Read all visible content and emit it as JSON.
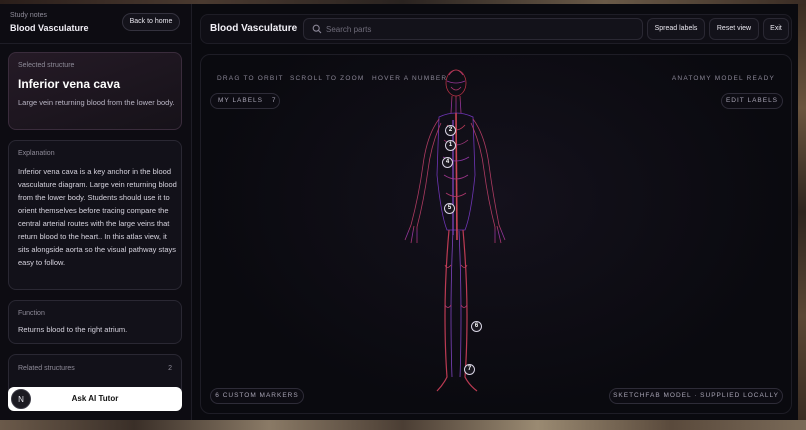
{
  "sidebar": {
    "study_label": "Study notes",
    "study_title": "Blood Vasculature",
    "back_label": "Back to home",
    "selected": {
      "label": "Selected structure",
      "name": "Inferior vena cava",
      "description": "Large vein returning blood from the lower body."
    },
    "explanation": {
      "label": "Explanation",
      "text": "Inferior vena cava is a key anchor in the blood vasculature diagram. Large vein returning blood from the lower body. Students should use it to orient themselves before tracing compare the central arterial routes with the large veins that return blood to the heart.. In this atlas view, it sits alongside aorta so the visual pathway stays easy to follow."
    },
    "function": {
      "label": "Function",
      "text": "Returns blood to the right atrium."
    },
    "related": {
      "label": "Related structures",
      "count": "2"
    },
    "tutor": {
      "avatar_letter": "N",
      "label": "Ask AI Tutor"
    }
  },
  "topbar": {
    "title": "Blood Vasculature",
    "search_placeholder": "Search parts",
    "spread_label": "Spread labels",
    "reset_label": "Reset view",
    "exit_label": "Exit"
  },
  "viewer": {
    "hints": [
      "DRAG TO ORBIT",
      "SCROLL TO ZOOM",
      "HOVER A NUMBER"
    ],
    "status": "ANATOMY MODEL READY",
    "my_labels": "MY LABELS",
    "my_labels_count": "7",
    "edit_labels": "EDIT LABELS",
    "custom_markers": "6 CUSTOM MARKERS",
    "source": "SKETCHFAB MODEL · SUPPLIED LOCALLY",
    "markers": [
      "2",
      "1",
      "4",
      "5",
      "6",
      "7"
    ]
  },
  "colors": {
    "accent": "#c04a7a",
    "vessel_red": "#c8364a",
    "vessel_purple": "#7a3ac8"
  }
}
